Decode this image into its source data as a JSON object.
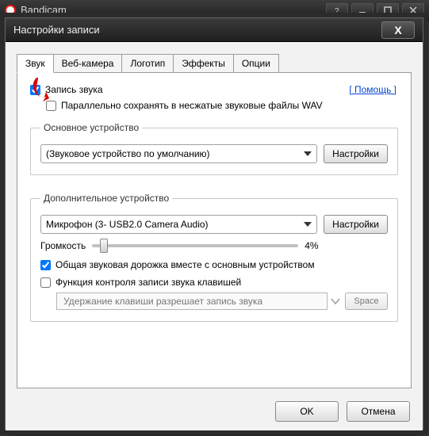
{
  "app": {
    "name": "Bandicam"
  },
  "dialog": {
    "title": "Настройки записи",
    "close": "X",
    "tabs": [
      "Звук",
      "Веб-камера",
      "Логотип",
      "Эффекты",
      "Опции"
    ],
    "activeTab": 0,
    "help": "[ Помощь ]",
    "recordSound": {
      "label": "Запись звука",
      "checked": true
    },
    "saveWav": {
      "label": "Параллельно сохранять в несжатые звуковые файлы WAV",
      "checked": false
    },
    "mainDevice": {
      "legend": "Основное устройство",
      "selected": "(Звуковое устройство по умолчанию)",
      "settingsBtn": "Настройки"
    },
    "secondaryDevice": {
      "legend": "Дополнительное устройство",
      "selected": "Микрофон (3- USB2.0 Camera Audio)",
      "settingsBtn": "Настройки",
      "volumeLabel": "Громкость",
      "volumeValue": 4,
      "volumeDisplay": "4%",
      "mixWithMain": {
        "label": "Общая звуковая дорожка вместе с основным устройством",
        "checked": true
      },
      "hotkeyToggle": {
        "label": "Функция контроля записи звука клавишей",
        "checked": false
      },
      "hotkeyPlaceholder": "Удержание клавиши разрешает запись звука",
      "spaceBtn": "Space"
    },
    "footer": {
      "ok": "OK",
      "cancel": "Отмена"
    }
  }
}
